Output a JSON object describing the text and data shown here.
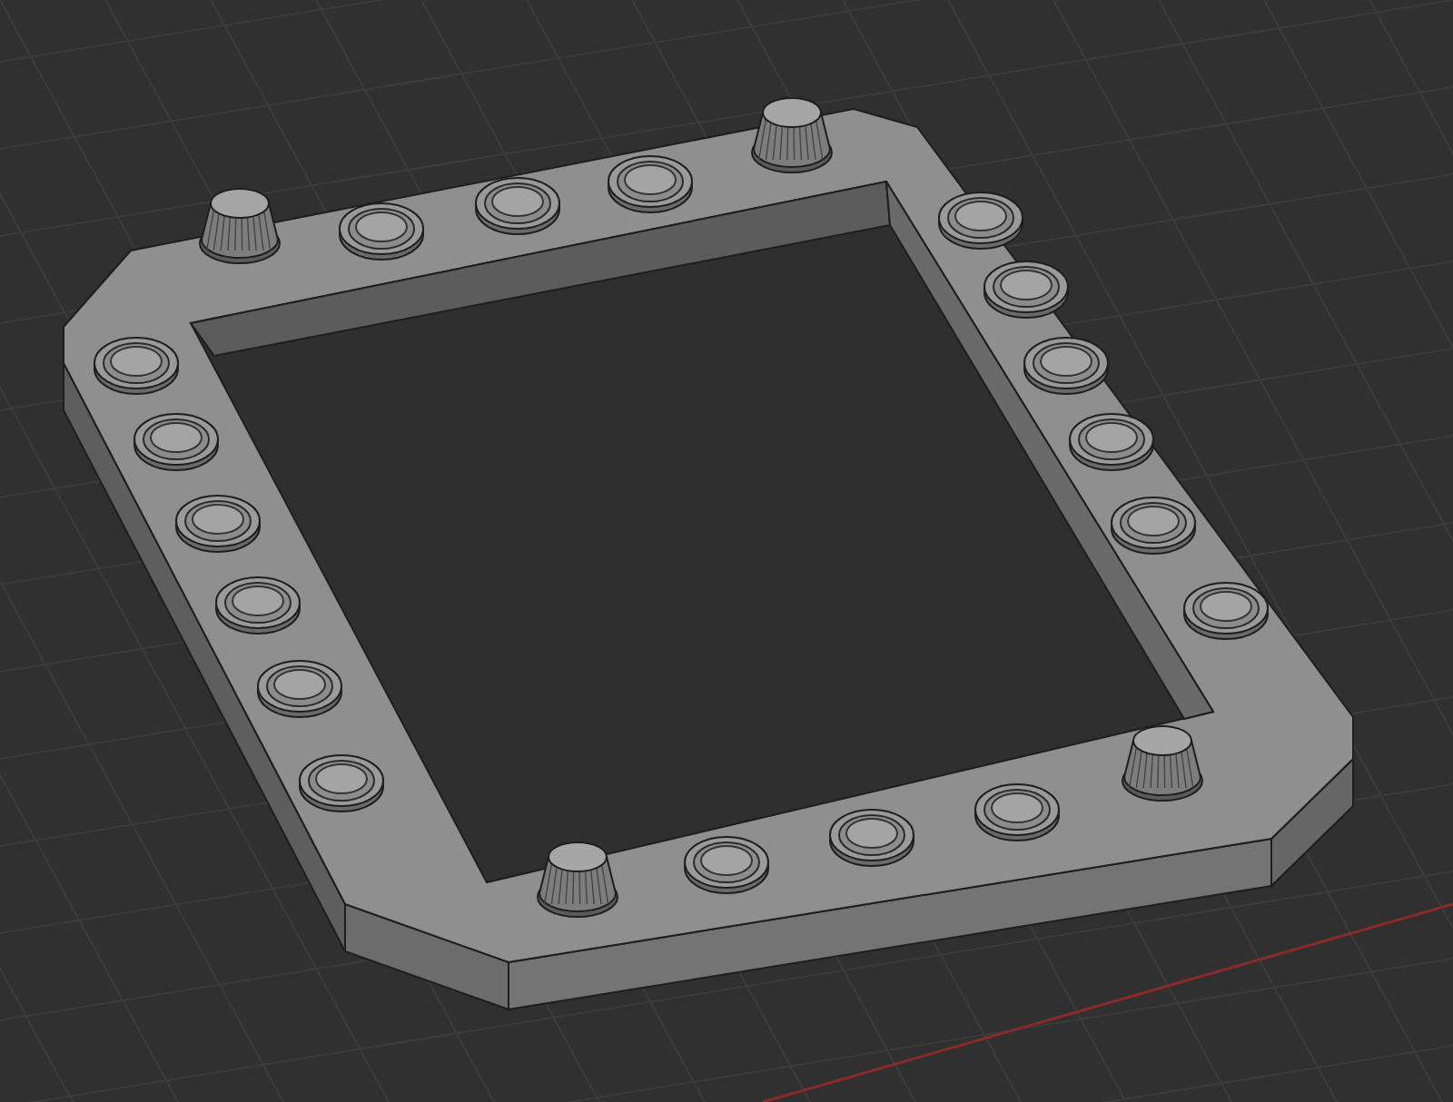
{
  "viewport": {
    "object": {
      "kind": "bezel"
    },
    "axis": {
      "kind": "x"
    }
  }
}
